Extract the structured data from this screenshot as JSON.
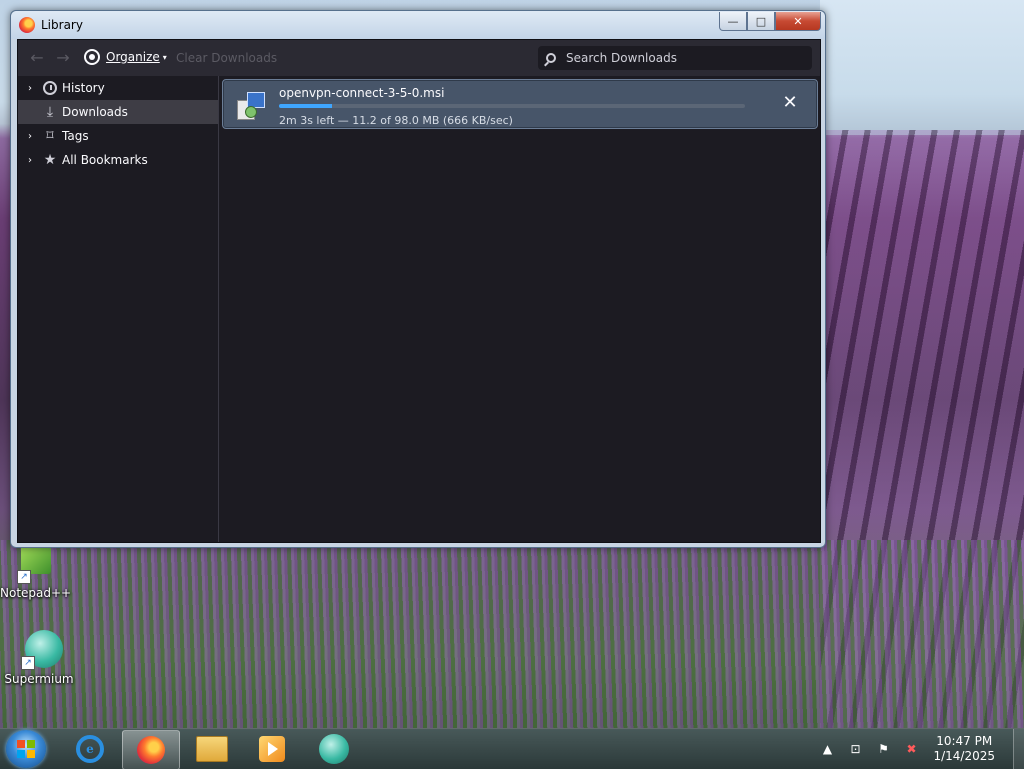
{
  "window": {
    "title": "Library",
    "controls": {
      "minimize": "—",
      "maximize": "□",
      "close": "✕"
    }
  },
  "toolbar": {
    "back_icon": "back-arrow-icon",
    "forward_icon": "forward-arrow-icon",
    "organize_label": "Organize",
    "clear_downloads_label": "Clear Downloads",
    "search": {
      "placeholder": "Search Downloads",
      "value": ""
    }
  },
  "sidebar": {
    "items": [
      {
        "label": "History",
        "icon": "clock-icon",
        "expandable": true,
        "selected": false
      },
      {
        "label": "Downloads",
        "icon": "download-icon",
        "expandable": false,
        "selected": true
      },
      {
        "label": "Tags",
        "icon": "tag-icon",
        "expandable": true,
        "selected": false
      },
      {
        "label": "All Bookmarks",
        "icon": "star-icon",
        "expandable": true,
        "selected": false
      }
    ]
  },
  "downloads": [
    {
      "filename": "openvpn-connect-3-5-0.msi",
      "status": "2m 3s left — 11.2 of 98.0 MB (666 KB/sec)",
      "progress": 0.114,
      "icon": "installer-package-icon"
    }
  ],
  "desktop_icons": [
    {
      "label": "Notepad++",
      "icon": "notepadpp-icon"
    },
    {
      "label": "Supermium",
      "icon": "supermium-icon"
    }
  ],
  "taskbar": {
    "apps": [
      {
        "name": "internet-explorer",
        "icon": "ie-icon",
        "active": false
      },
      {
        "name": "firefox",
        "icon": "firefox-icon",
        "active": true
      },
      {
        "name": "file-explorer",
        "icon": "folder-icon",
        "active": false
      },
      {
        "name": "media-player",
        "icon": "media-player-icon",
        "active": false
      },
      {
        "name": "supermium",
        "icon": "supermium-icon",
        "active": false
      }
    ],
    "time": "10:47 PM",
    "date": "1/14/2025"
  },
  "colors": {
    "client_bg": "#1c1b22",
    "toolbar_bg": "#2b2a33",
    "selected_item_bg": "#3e3d45",
    "download_item_bg": "#475569",
    "progress_fill": "#3fa6ff"
  }
}
